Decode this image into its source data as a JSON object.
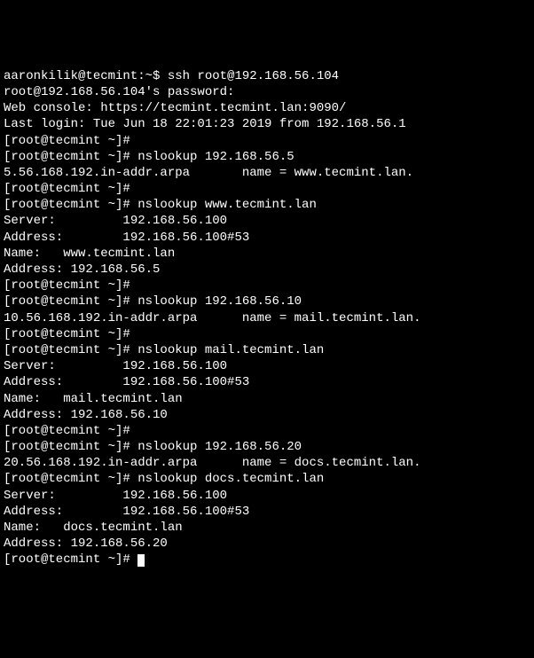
{
  "lines": {
    "l1": "aaronkilik@tecmint:~$ ssh root@192.168.56.104",
    "l2": "root@192.168.56.104's password:",
    "l3": "Web console: https://tecmint.tecmint.lan:9090/",
    "l4": "",
    "l5": "Last login: Tue Jun 18 22:01:23 2019 from 192.168.56.1",
    "l6": "[root@tecmint ~]#",
    "l7": "[root@tecmint ~]# nslookup 192.168.56.5",
    "l8": "5.56.168.192.in-addr.arpa       name = www.tecmint.lan.",
    "l9": "",
    "l10": "[root@tecmint ~]#",
    "l11": "[root@tecmint ~]# nslookup www.tecmint.lan",
    "l12": "Server:         192.168.56.100",
    "l13": "Address:        192.168.56.100#53",
    "l14": "",
    "l15": "Name:   www.tecmint.lan",
    "l16": "Address: 192.168.56.5",
    "l17": "",
    "l18": "[root@tecmint ~]#",
    "l19": "[root@tecmint ~]# nslookup 192.168.56.10",
    "l20": "10.56.168.192.in-addr.arpa      name = mail.tecmint.lan.",
    "l21": "",
    "l22": "[root@tecmint ~]#",
    "l23": "[root@tecmint ~]# nslookup mail.tecmint.lan",
    "l24": "Server:         192.168.56.100",
    "l25": "Address:        192.168.56.100#53",
    "l26": "",
    "l27": "Name:   mail.tecmint.lan",
    "l28": "Address: 192.168.56.10",
    "l29": "",
    "l30": "[root@tecmint ~]#",
    "l31": "[root@tecmint ~]# nslookup 192.168.56.20",
    "l32": "20.56.168.192.in-addr.arpa      name = docs.tecmint.lan.",
    "l33": "",
    "l34": "[root@tecmint ~]# nslookup docs.tecmint.lan",
    "l35": "Server:         192.168.56.100",
    "l36": "Address:        192.168.56.100#53",
    "l37": "",
    "l38": "Name:   docs.tecmint.lan",
    "l39": "Address: 192.168.56.20",
    "l40": "",
    "l41": "[root@tecmint ~]# "
  }
}
